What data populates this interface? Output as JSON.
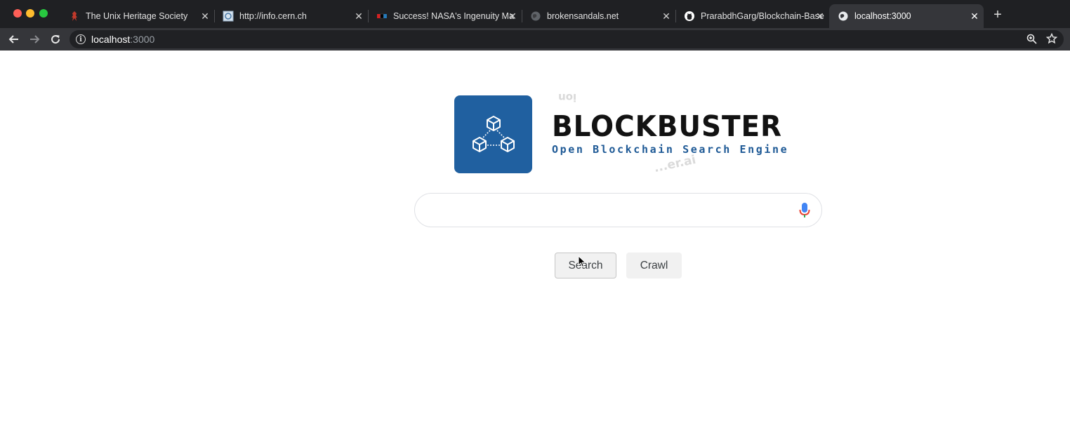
{
  "browser": {
    "tabs": [
      {
        "title": "The Unix Heritage Society",
        "favicon": "daemon-icon",
        "active": false
      },
      {
        "title": "http://info.cern.ch",
        "favicon": "page-icon",
        "active": false
      },
      {
        "title": "Success! NASA's Ingenuity Ma",
        "favicon": "npr-icon",
        "active": false
      },
      {
        "title": "brokensandals.net",
        "favicon": "globe-icon",
        "active": false
      },
      {
        "title": "PrarabdhGarg/Blockchain-Base",
        "favicon": "github-icon",
        "active": false
      },
      {
        "title": "localhost:3000",
        "favicon": "globe-icon",
        "active": true
      }
    ],
    "new_tab_label": "+",
    "address": {
      "host": "localhost",
      "port": ":3000"
    }
  },
  "page": {
    "brand_name": "BLOCKBUSTER",
    "tagline": "Open Blockchain Search Engine",
    "watermark_top": "ion",
    "watermark_bottom": "...er.ai",
    "search": {
      "value": "",
      "placeholder": ""
    },
    "buttons": {
      "search_label": "Search",
      "crawl_label": "Crawl"
    }
  },
  "colors": {
    "logo_background": "#2060a0",
    "tagline": "#1f5a96",
    "brand_text": "#121212"
  }
}
